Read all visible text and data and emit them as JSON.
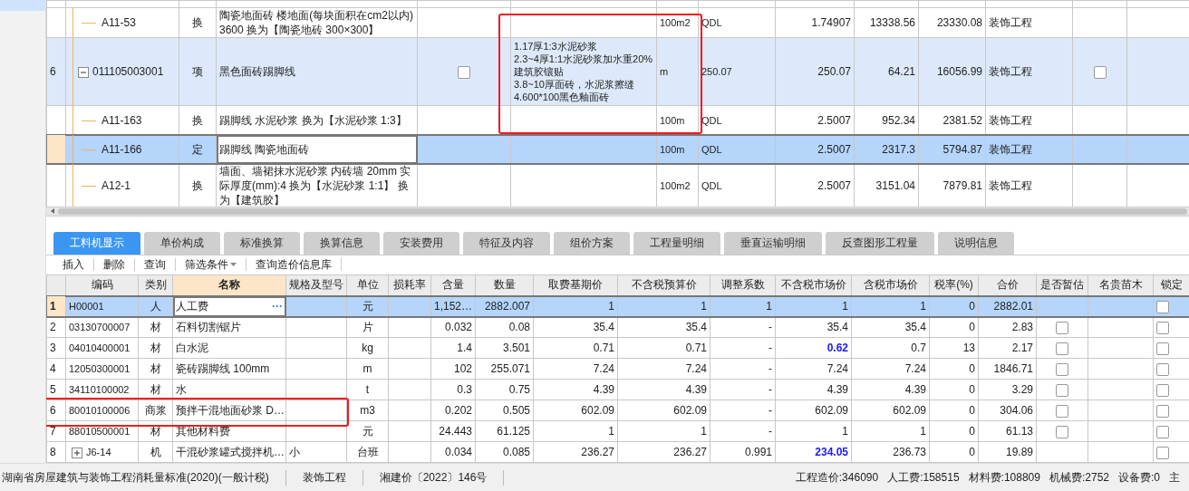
{
  "sidebar": {
    "items": [
      {
        "selected": true
      }
    ]
  },
  "upper_table": {
    "rows": [
      {
        "kind": "sub",
        "code": "A11-53",
        "type": "换",
        "name": "陶瓷地面砖 楼地面(每块面积在cm2以内) 3600  换为【陶瓷地砖 300×300】",
        "unit": "100m2",
        "qty_expr": "QDL",
        "quantity": "1.74907",
        "unit_price": "13338.56",
        "total": "23330.08",
        "specialty": "装饰工程",
        "selected": false
      },
      {
        "kind": "item",
        "number": "6",
        "code": "011105003001",
        "type": "项",
        "name": "黑色面砖踢脚线",
        "flag_checked": false,
        "features": [
          "1.17厚1:3水泥砂浆",
          "2.3~4厚1:1水泥砂浆加水重20%建筑胶镶贴",
          "3.8~10厚面砖，水泥浆擦缝",
          "4.600*100黑色釉面砖"
        ],
        "marked": true,
        "unit": "m",
        "qty_expr": "250.07",
        "quantity": "250.07",
        "unit_price": "64.21",
        "total": "16056.99",
        "specialty": "装饰工程",
        "tail_checked": false,
        "selected": false,
        "expanded": true,
        "children": [
          {
            "kind": "sub",
            "code": "A11-163",
            "type": "换",
            "name": "踢脚线 水泥砂浆  换为【水泥砂浆 1:3】",
            "unit": "100m",
            "qty_expr": "QDL",
            "quantity": "2.5007",
            "unit_price": "952.34",
            "total": "2381.52",
            "specialty": "装饰工程",
            "selected": false
          },
          {
            "kind": "sub",
            "code": "A11-166",
            "type": "定",
            "name": "踢脚线 陶瓷地面砖",
            "unit": "100m",
            "qty_expr": "QDL",
            "quantity": "2.5007",
            "unit_price": "2317.3",
            "total": "5794.87",
            "specialty": "装饰工程",
            "selected": true
          },
          {
            "kind": "sub",
            "code": "A12-1",
            "type": "换",
            "name": "墙面、墙裙抹水泥砂浆 内砖墙 20mm  实际厚度(mm):4  换为【水泥砂浆 1:1】 换为【建筑胶】",
            "unit": "100m2",
            "qty_expr": "QDL",
            "quantity": "2.5007",
            "unit_price": "3151.04",
            "total": "7879.81",
            "specialty": "装饰工程",
            "selected": false
          }
        ]
      }
    ]
  },
  "tabs": [
    {
      "label": "工料机显示",
      "selected": true
    },
    {
      "label": "单价构成",
      "selected": false
    },
    {
      "label": "标准换算",
      "selected": false
    },
    {
      "label": "换算信息",
      "selected": false
    },
    {
      "label": "安装费用",
      "selected": false
    },
    {
      "label": "特征及内容",
      "selected": false
    },
    {
      "label": "组价方案",
      "selected": false
    },
    {
      "label": "工程量明细",
      "selected": false
    },
    {
      "label": "垂直运输明细",
      "selected": false
    },
    {
      "label": "反查图形工程量",
      "selected": false
    },
    {
      "label": "说明信息",
      "selected": false
    }
  ],
  "toolbar": [
    {
      "label": "插入",
      "dropdown": false
    },
    {
      "label": "删除",
      "dropdown": false
    },
    {
      "label": "查询",
      "dropdown": false
    },
    {
      "label": "筛选条件",
      "dropdown": true
    },
    {
      "label": "查询造价信息库",
      "dropdown": false
    }
  ],
  "lower_table": {
    "columns": [
      {
        "label": "编码",
        "selected": false
      },
      {
        "label": "类别",
        "selected": false
      },
      {
        "label": "名称",
        "selected": true
      },
      {
        "label": "规格及型号",
        "selected": false
      },
      {
        "label": "单位",
        "selected": false
      },
      {
        "label": "损耗率",
        "selected": false
      },
      {
        "label": "含量",
        "selected": false
      },
      {
        "label": "数量",
        "selected": false
      },
      {
        "label": "取费基期价",
        "selected": false
      },
      {
        "label": "不含税预算价",
        "selected": false
      },
      {
        "label": "调整系数",
        "selected": false
      },
      {
        "label": "不含税市场价",
        "selected": false
      },
      {
        "label": "含税市场价",
        "selected": false
      },
      {
        "label": "税率(%)",
        "selected": false
      },
      {
        "label": "合价",
        "selected": false
      },
      {
        "label": "是否暂估",
        "selected": false
      },
      {
        "label": "名贵苗木",
        "selected": false
      },
      {
        "label": "锁定",
        "selected": false
      }
    ],
    "rows": [
      {
        "number": "1",
        "code": "H00001",
        "type": "人",
        "name": "人工费",
        "name_action": "···",
        "spec": "",
        "unit": "元",
        "content": "1,152…",
        "quantity": "2882.007",
        "base_price": "1",
        "budget_price": "1",
        "coefficient": "1",
        "market_price": "1",
        "market_changed": false,
        "tax_market_price": "1",
        "tax_rate": "0",
        "total": "2882.01",
        "locked": false,
        "selected": true
      },
      {
        "number": "2",
        "code": "03130700007",
        "type": "材",
        "name": "石料切割锯片",
        "unit": "片",
        "content": "0.032",
        "quantity": "0.08",
        "base_price": "35.4",
        "budget_price": "35.4",
        "coefficient": "-",
        "market_price": "35.4",
        "market_changed": false,
        "tax_market_price": "35.4",
        "tax_rate": "0",
        "total": "2.83",
        "provisional": false,
        "locked": false,
        "selected": false
      },
      {
        "number": "3",
        "code": "04010400001",
        "type": "材",
        "name": "白水泥",
        "unit": "kg",
        "content": "1.4",
        "quantity": "3.501",
        "base_price": "0.71",
        "budget_price": "0.71",
        "coefficient": "-",
        "market_price": "0.62",
        "market_changed": true,
        "tax_market_price": "0.7",
        "tax_rate": "13",
        "total": "2.17",
        "provisional": false,
        "locked": false,
        "selected": false
      },
      {
        "number": "4",
        "code": "12050300001",
        "type": "材",
        "name": "瓷砖踢脚线 100mm",
        "unit": "m",
        "content": "102",
        "quantity": "255.071",
        "base_price": "7.24",
        "budget_price": "7.24",
        "coefficient": "-",
        "market_price": "7.24",
        "market_changed": false,
        "tax_market_price": "7.24",
        "tax_rate": "0",
        "total": "1846.71",
        "provisional": false,
        "locked": false,
        "selected": false
      },
      {
        "number": "5",
        "code": "34110100002",
        "type": "材",
        "name": "水",
        "unit": "t",
        "content": "0.3",
        "quantity": "0.75",
        "base_price": "4.39",
        "budget_price": "4.39",
        "coefficient": "-",
        "market_price": "4.39",
        "market_changed": false,
        "tax_market_price": "4.39",
        "tax_rate": "0",
        "total": "3.29",
        "provisional": false,
        "locked": false,
        "selected": false
      },
      {
        "number": "6",
        "code": "80010100006",
        "type": "商浆",
        "name": "预拌干混地面砂浆 D…",
        "unit": "m3",
        "content": "0.202",
        "quantity": "0.505",
        "base_price": "602.09",
        "budget_price": "602.09",
        "coefficient": "-",
        "market_price": "602.09",
        "market_changed": false,
        "tax_market_price": "602.09",
        "tax_rate": "0",
        "total": "304.06",
        "provisional": false,
        "locked": false,
        "selected": false,
        "marked": true
      },
      {
        "number": "7",
        "code": "88010500001",
        "type": "材",
        "name": "其他材料费",
        "unit": "元",
        "content": "24.443",
        "quantity": "61.125",
        "base_price": "1",
        "budget_price": "1",
        "coefficient": "-",
        "market_price": "1",
        "market_changed": false,
        "tax_market_price": "1",
        "tax_rate": "0",
        "total": "61.13",
        "provisional": false,
        "locked": false,
        "selected": false
      },
      {
        "number": "8",
        "code": "J6-14",
        "expanded": false,
        "type": "机",
        "name": "干混砂浆罐式搅拌机…",
        "spec": "小",
        "unit": "台班",
        "content": "0.034",
        "quantity": "0.085",
        "base_price": "236.27",
        "budget_price": "236.27",
        "coefficient": "0.991",
        "market_price": "234.05",
        "market_changed": true,
        "tax_market_price": "236.73",
        "tax_rate": "0",
        "total": "19.89",
        "locked": false,
        "selected": false
      }
    ]
  },
  "status_bar": {
    "left": [
      "湖南省房屋建筑与装饰工程消耗量标准(2020)(一般计税)",
      "装饰工程",
      "湘建价〔2022〕146号"
    ],
    "right": [
      "工程造价:346090",
      "人工费:158515",
      "材料费:108809",
      "机械费:2752",
      "设备费:0",
      "主"
    ]
  }
}
